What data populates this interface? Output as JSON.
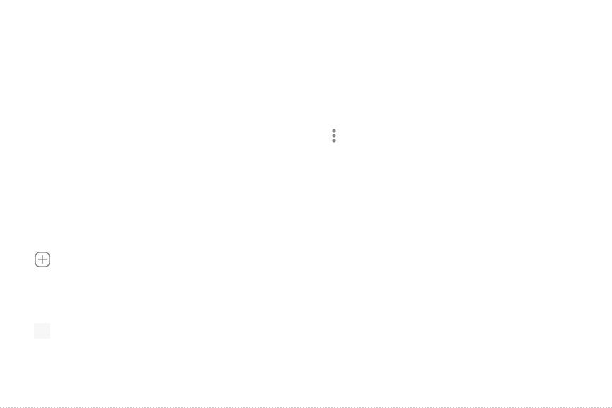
{
  "screen": {
    "background": "#ffffff"
  },
  "icons": {
    "overflow_menu": {
      "name": "more-vertical-icon",
      "color": "#8a8a8a"
    },
    "add": {
      "name": "add-square-icon",
      "color": "#7a7a7a"
    },
    "placeholder": {
      "color": "#f7f7f7"
    }
  }
}
